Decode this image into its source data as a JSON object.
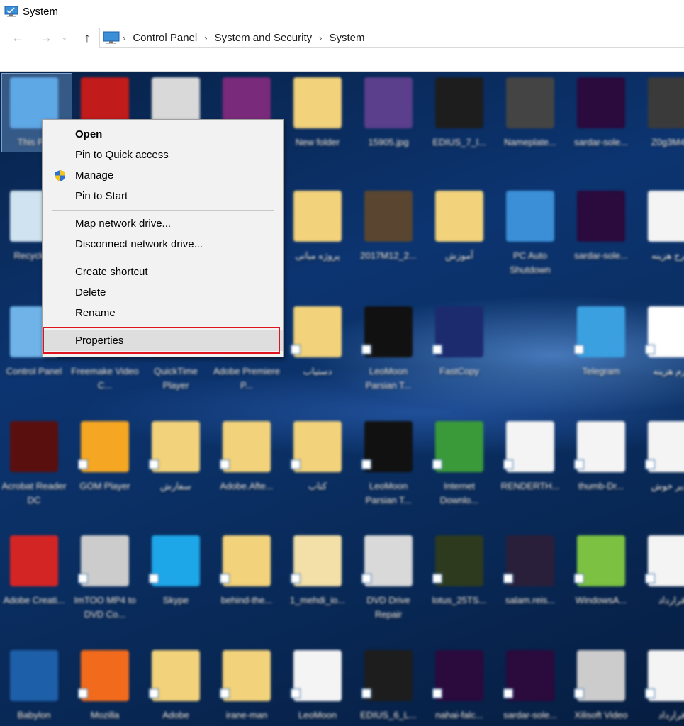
{
  "window": {
    "title": "System",
    "breadcrumb": [
      "Control Panel",
      "System and Security",
      "System"
    ]
  },
  "context_menu": {
    "items": [
      {
        "label": "Open",
        "bold": true
      },
      {
        "label": "Pin to Quick access"
      },
      {
        "label": "Manage",
        "icon": "uac-shield-icon"
      },
      {
        "label": "Pin to Start"
      },
      {
        "label": "Map network drive..."
      },
      {
        "label": "Disconnect network drive..."
      },
      {
        "label": "Create shortcut"
      },
      {
        "label": "Delete"
      },
      {
        "label": "Rename"
      },
      {
        "label": "Properties",
        "highlighted": true
      }
    ],
    "highlight_color": "#e0141e"
  },
  "desktop": {
    "icons": [
      {
        "label": "This PC",
        "color": "#5fa8e6",
        "row": 0,
        "col": 0
      },
      {
        "label": "",
        "color": "#c21b1b",
        "row": 0,
        "col": 1
      },
      {
        "label": "",
        "color": "#d9d9d9",
        "row": 0,
        "col": 2
      },
      {
        "label": "",
        "color": "#7a2a7a",
        "row": 0,
        "col": 3
      },
      {
        "label": "New folder",
        "color": "#f2d27a",
        "row": 0,
        "col": 4
      },
      {
        "label": "15905.jpg",
        "color": "#5b3f8c",
        "row": 0,
        "col": 5
      },
      {
        "label": "EDIUS_7_l...",
        "color": "#1d1d1d",
        "row": 0,
        "col": 6
      },
      {
        "label": "Nameplate...",
        "color": "#444444",
        "row": 0,
        "col": 7
      },
      {
        "label": "sardar-sole...",
        "color": "#2b0a3d",
        "row": 0,
        "col": 8
      },
      {
        "label": "Z0g3M4...",
        "color": "#3a3a3a",
        "row": 0,
        "col": 9
      },
      {
        "label": "Recycle...",
        "color": "#cfe3f0",
        "row": 1,
        "col": 0
      },
      {
        "label": "پروژه مبانی",
        "color": "#f2d27a",
        "row": 1,
        "col": 4
      },
      {
        "label": "2017M12_2...",
        "color": "#5a4630",
        "row": 1,
        "col": 5
      },
      {
        "label": "آموزش",
        "color": "#f2d27a",
        "row": 1,
        "col": 6
      },
      {
        "label": "PC Auto Shutdown",
        "color": "#3b8fd6",
        "row": 1,
        "col": 7
      },
      {
        "label": "sardar-sole...",
        "color": "#2b0a3d",
        "row": 1,
        "col": 8
      },
      {
        "label": "طرح هزینه",
        "color": "#f4f4f4",
        "row": 1,
        "col": 9
      },
      {
        "label": "Control Panel",
        "color": "#6fb3e8",
        "row": 2,
        "col": 0
      },
      {
        "label": "Freemake Video C...",
        "color": "#2b2b2b",
        "row": 2,
        "col": 1
      },
      {
        "label": "QuickTime Player",
        "color": "#2b2b2b",
        "row": 2,
        "col": 2
      },
      {
        "label": "Adobe Premiere P...",
        "color": "#2b2b2b",
        "row": 2,
        "col": 3
      },
      {
        "label": "دستیاب",
        "color": "#f2d27a",
        "row": 2,
        "col": 4
      },
      {
        "label": "LeoMoon Parsian T...",
        "color": "#111111",
        "row": 2,
        "col": 5
      },
      {
        "label": "FastCopy",
        "color": "#1c2a6e",
        "row": 2,
        "col": 6
      },
      {
        "label": "Telegram",
        "color": "#3aa0e0",
        "row": 2,
        "col": 8
      },
      {
        "label": "فرم هزینه",
        "color": "#ffffff",
        "row": 2,
        "col": 9
      },
      {
        "label": "Acrobat Reader DC",
        "color": "#5a0f0f",
        "row": 3,
        "col": 0
      },
      {
        "label": "GOM Player",
        "color": "#f5a623",
        "row": 3,
        "col": 1
      },
      {
        "label": "سفارش",
        "color": "#f2d27a",
        "row": 3,
        "col": 2
      },
      {
        "label": "Adobe.Afte...",
        "color": "#f2d27a",
        "row": 3,
        "col": 3
      },
      {
        "label": "کتاب",
        "color": "#f2d27a",
        "row": 3,
        "col": 4
      },
      {
        "label": "LeoMoon Parsian T...",
        "color": "#111111",
        "row": 3,
        "col": 5
      },
      {
        "label": "Internet Downlo...",
        "color": "#3a9a3a",
        "row": 3,
        "col": 6
      },
      {
        "label": "RENDERTH...",
        "color": "#f4f4f4",
        "row": 3,
        "col": 7
      },
      {
        "label": "thumb-Dr...",
        "color": "#f4f4f4",
        "row": 3,
        "col": 8
      },
      {
        "label": "مدیر خوش",
        "color": "#f4f4f4",
        "row": 3,
        "col": 9
      },
      {
        "label": "Adobe Creati...",
        "color": "#d42525",
        "row": 4,
        "col": 0
      },
      {
        "label": "ImTOO MP4 to DVD Co...",
        "color": "#cccccc",
        "row": 4,
        "col": 1
      },
      {
        "label": "Skype",
        "color": "#1ea7e8",
        "row": 4,
        "col": 2
      },
      {
        "label": "behind-the...",
        "color": "#f2d27a",
        "row": 4,
        "col": 3
      },
      {
        "label": "1_mehdi_io...",
        "color": "#f2e0a8",
        "row": 4,
        "col": 4
      },
      {
        "label": "DVD Drive Repair",
        "color": "#d9d9d9",
        "row": 4,
        "col": 5
      },
      {
        "label": "lotus_25TS...",
        "color": "#2d3a1e",
        "row": 4,
        "col": 6
      },
      {
        "label": "salam.reis...",
        "color": "#2a1f3a",
        "row": 4,
        "col": 7
      },
      {
        "label": "WindowsA...",
        "color": "#7cc142",
        "row": 4,
        "col": 8
      },
      {
        "label": "قرارداد",
        "color": "#f4f4f4",
        "row": 4,
        "col": 9
      },
      {
        "label": "Babylon",
        "color": "#1d5fa8",
        "row": 5,
        "col": 0
      },
      {
        "label": "Mozilla",
        "color": "#f26b1d",
        "row": 5,
        "col": 1
      },
      {
        "label": "Adobe",
        "color": "#f2d27a",
        "row": 5,
        "col": 2
      },
      {
        "label": "irane-man",
        "color": "#f2d27a",
        "row": 5,
        "col": 3
      },
      {
        "label": "LeoMoon",
        "color": "#f4f4f4",
        "row": 5,
        "col": 4
      },
      {
        "label": "EDIUS_6_L...",
        "color": "#1d1d1d",
        "row": 5,
        "col": 5
      },
      {
        "label": "nahai-falc...",
        "color": "#2b0a3d",
        "row": 5,
        "col": 6
      },
      {
        "label": "sardar-sole...",
        "color": "#2b0a3d",
        "row": 5,
        "col": 7
      },
      {
        "label": "Xilisoft Video",
        "color": "#cccccc",
        "row": 5,
        "col": 8
      },
      {
        "label": "قرارداد",
        "color": "#f4f4f4",
        "row": 5,
        "col": 9
      }
    ]
  }
}
